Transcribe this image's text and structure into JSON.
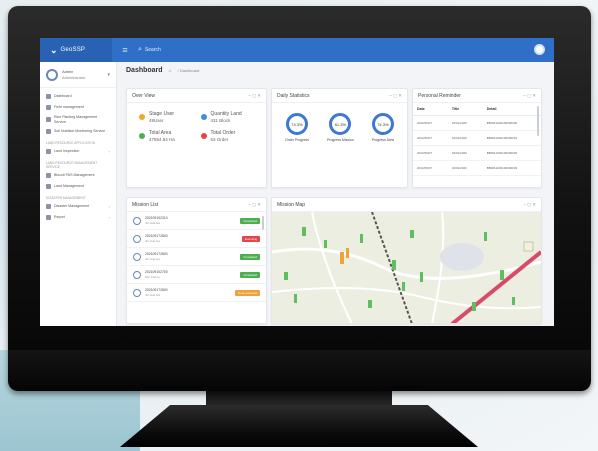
{
  "colors": {
    "topbar": "#2f6fc7",
    "accent": "#3c78d8",
    "status_green": "#4cb050",
    "status_red": "#e5454a",
    "status_orange": "#f0a23a",
    "overview_dots": [
      "#f5a623",
      "#3c90d6",
      "#4cb050",
      "#e5454a"
    ]
  },
  "app": {
    "logo_mark": "⌄",
    "logo_text": "GeoSSP",
    "search_placeholder": "Search"
  },
  "sidebar": {
    "profile_name": "Admin",
    "profile_role": "Administrator",
    "items": [
      {
        "type": "item",
        "label": "Dashboard",
        "caret": ""
      },
      {
        "type": "item",
        "label": "Field management",
        "caret": ""
      },
      {
        "type": "item",
        "label": "Rice Planting Management Service",
        "caret": ""
      },
      {
        "type": "item",
        "label": "Soil Nutrition Monitoring Service",
        "caret": ""
      },
      {
        "type": "section",
        "label": "Land Resource Application"
      },
      {
        "type": "item",
        "label": "Land Inspection",
        "caret": "›"
      },
      {
        "type": "section",
        "label": "Land Resource Management Service"
      },
      {
        "type": "item",
        "label": "Biscuit PAS Management",
        "caret": ""
      },
      {
        "type": "item",
        "label": "Land Management",
        "caret": ""
      },
      {
        "type": "section",
        "label": "Disaster Management"
      },
      {
        "type": "item",
        "label": "Disaster Management",
        "caret": "›"
      },
      {
        "type": "item",
        "label": "Report",
        "caret": "›"
      }
    ]
  },
  "header": {
    "page_title": "Dashboard",
    "home_icon": "⌂",
    "breadcrumb": "/  Dashboard"
  },
  "controls": "– ◻ ✕",
  "overview": {
    "title": "Over View",
    "items": [
      {
        "label": "Stage User",
        "value": "49User"
      },
      {
        "label": "Quantity Land",
        "value": "431 Block"
      },
      {
        "label": "Total Area",
        "value": "47854.94 Ha"
      },
      {
        "label": "Total Order",
        "value": "63 Order"
      }
    ]
  },
  "stats": {
    "title": "Daily Statistics",
    "items": [
      {
        "value": "74.3%",
        "caption": "Order Progress"
      },
      {
        "value": "61.3%",
        "caption": "Progress Mission"
      },
      {
        "value": "74.3%",
        "caption": "Progress Area"
      }
    ]
  },
  "reminder": {
    "title": "Personal Reminder",
    "columns": [
      "Date",
      "Title",
      "Detail"
    ],
    "rows": [
      [
        "2022/06/07",
        "04/01/2020",
        "BB0011000100000000"
      ],
      [
        "2022/06/07",
        "04/01/2020",
        "BB0011000100000001"
      ],
      [
        "2022/06/07",
        "04/01/2020",
        "BB0011000100000002"
      ],
      [
        "2022/06/07",
        "04/01/2020",
        "BB0011000100000003"
      ]
    ]
  },
  "missions": {
    "title": "Mission List",
    "items": [
      {
        "code": "202109102310",
        "name": "Jiu Hua Ga",
        "status": "Completed",
        "kind": "green"
      },
      {
        "code": "202109172800",
        "name": "Jiu Hua Ga",
        "status": "Executing",
        "kind": "red"
      },
      {
        "code": "202109172800",
        "name": "Jiu Hua Ga",
        "status": "Completed",
        "kind": "green"
      },
      {
        "code": "202109102700",
        "name": "Mei Cheng",
        "status": "Completed",
        "kind": "green"
      },
      {
        "code": "202109172800",
        "name": "Jiu Hua Ga",
        "status": "To be executed",
        "kind": "orange"
      }
    ]
  },
  "map": {
    "title": "Mission Map"
  }
}
